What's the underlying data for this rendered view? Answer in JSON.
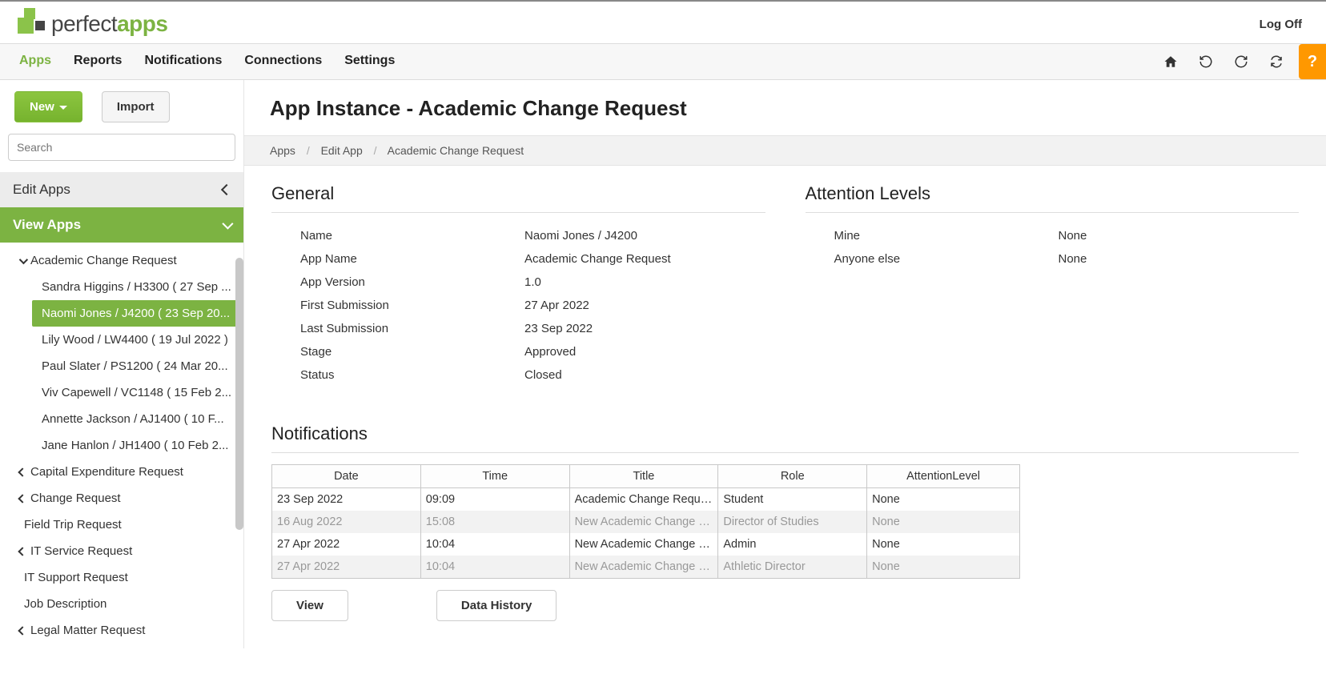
{
  "header": {
    "brand_a": "perfect",
    "brand_b": "apps",
    "logoff": "Log Off"
  },
  "nav": {
    "tabs": [
      "Apps",
      "Reports",
      "Notifications",
      "Connections",
      "Settings"
    ],
    "help": "?"
  },
  "sidebar": {
    "new_label": "New",
    "import_label": "Import",
    "search_placeholder": "Search",
    "edit_apps_label": "Edit Apps",
    "view_apps_label": "View Apps",
    "tree": {
      "expanded_app": "Academic Change Request",
      "instances": [
        "Sandra Higgins / H3300 ( 27 Sep ...",
        "Naomi Jones / J4200 ( 23 Sep 20...",
        "Lily Wood / LW4400 ( 19 Jul 2022 )",
        "Paul Slater / PS1200 ( 24 Mar 20...",
        "Viv Capewell / VC1148 ( 15 Feb 2...",
        "Annette Jackson / AJ1400 ( 10 F...",
        "Jane Hanlon / JH1400 ( 10 Feb 2..."
      ],
      "other_apps": [
        {
          "label": "Capital Expenditure Request",
          "chev": true
        },
        {
          "label": "Change Request",
          "chev": true
        },
        {
          "label": "Field Trip Request",
          "chev": false
        },
        {
          "label": "IT Service Request",
          "chev": true
        },
        {
          "label": "IT Support Request",
          "chev": false
        },
        {
          "label": "Job Description",
          "chev": false
        },
        {
          "label": "Legal Matter Request",
          "chev": true
        }
      ]
    }
  },
  "main": {
    "title": "App Instance - Academic Change Request",
    "breadcrumb": [
      "Apps",
      "Edit App",
      "Academic Change Request"
    ]
  },
  "general": {
    "heading": "General",
    "rows": [
      {
        "k": "Name",
        "v": "Naomi Jones / J4200"
      },
      {
        "k": "App Name",
        "v": "Academic Change Request"
      },
      {
        "k": "App Version",
        "v": "1.0"
      },
      {
        "k": "First Submission",
        "v": "27 Apr 2022"
      },
      {
        "k": "Last Submission",
        "v": "23 Sep 2022"
      },
      {
        "k": "Stage",
        "v": "Approved"
      },
      {
        "k": "Status",
        "v": "Closed"
      }
    ]
  },
  "attention": {
    "heading": "Attention Levels",
    "rows": [
      {
        "k": "Mine",
        "v": "None"
      },
      {
        "k": "Anyone else",
        "v": "None"
      }
    ]
  },
  "notifications": {
    "heading": "Notifications",
    "columns": [
      "Date",
      "Time",
      "Title",
      "Role",
      "AttentionLevel"
    ],
    "rows": [
      {
        "date": "23 Sep 2022",
        "time": "09:09",
        "title": "Academic Change Request Approved",
        "role": "Student",
        "att": "None",
        "dim": false
      },
      {
        "date": "16 Aug 2022",
        "time": "15:08",
        "title": "New Academic Change Request",
        "role": "Director of Studies",
        "att": "None",
        "dim": true
      },
      {
        "date": "27 Apr 2022",
        "time": "10:04",
        "title": "New Academic Change Request",
        "role": "Admin",
        "att": "None",
        "dim": false
      },
      {
        "date": "27 Apr 2022",
        "time": "10:04",
        "title": "New Academic Change Request",
        "role": "Athletic Director",
        "att": "None",
        "dim": true
      }
    ],
    "view_btn": "View",
    "history_btn": "Data History"
  }
}
